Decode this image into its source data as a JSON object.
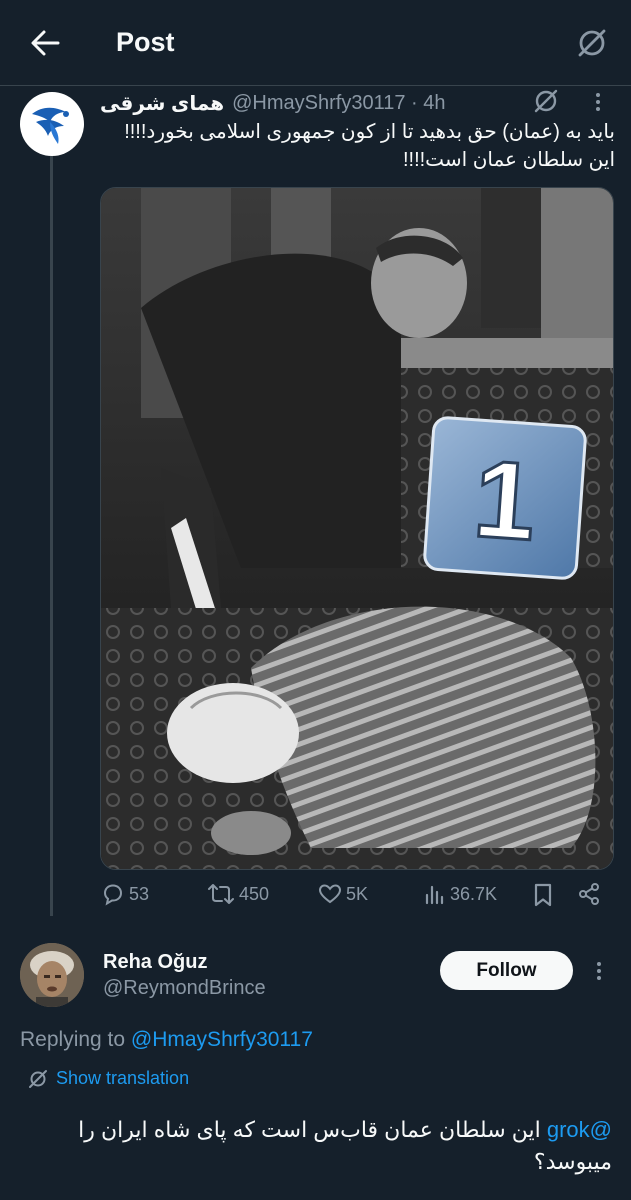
{
  "header": {
    "title": "Post",
    "back_icon": "arrow-left-icon",
    "grok_icon": "grok-icon"
  },
  "post": {
    "display_name": "همای شرقی",
    "handle_time": "@HmayShrfy30117 · 4h",
    "text_line1": "باید به (عمان) حق بدهید تا از کون جمهوری اسلامی بخورد!!!!",
    "text_line2": "این سلطان عمان است!!!!",
    "badge_number": "1",
    "stats": {
      "replies": "53",
      "reposts": "450",
      "likes": "5K",
      "views": "36.7K"
    }
  },
  "reply": {
    "display_name": "Reha Oğuz",
    "handle": "@ReymondBrince",
    "follow_label": "Follow",
    "replying_prefix": "Replying to",
    "replying_to": "@HmayShrfy30117",
    "show_translation": "Show translation",
    "mention": "@grok",
    "text_line1_rest": "این سلطان عمان قاب‌س است که پای شاه ایران را",
    "text_line2": "میبوسد؟"
  },
  "colors": {
    "background": "#15202b",
    "accent": "#1d9bf0",
    "muted": "#8b98a5",
    "border": "#38444d"
  }
}
